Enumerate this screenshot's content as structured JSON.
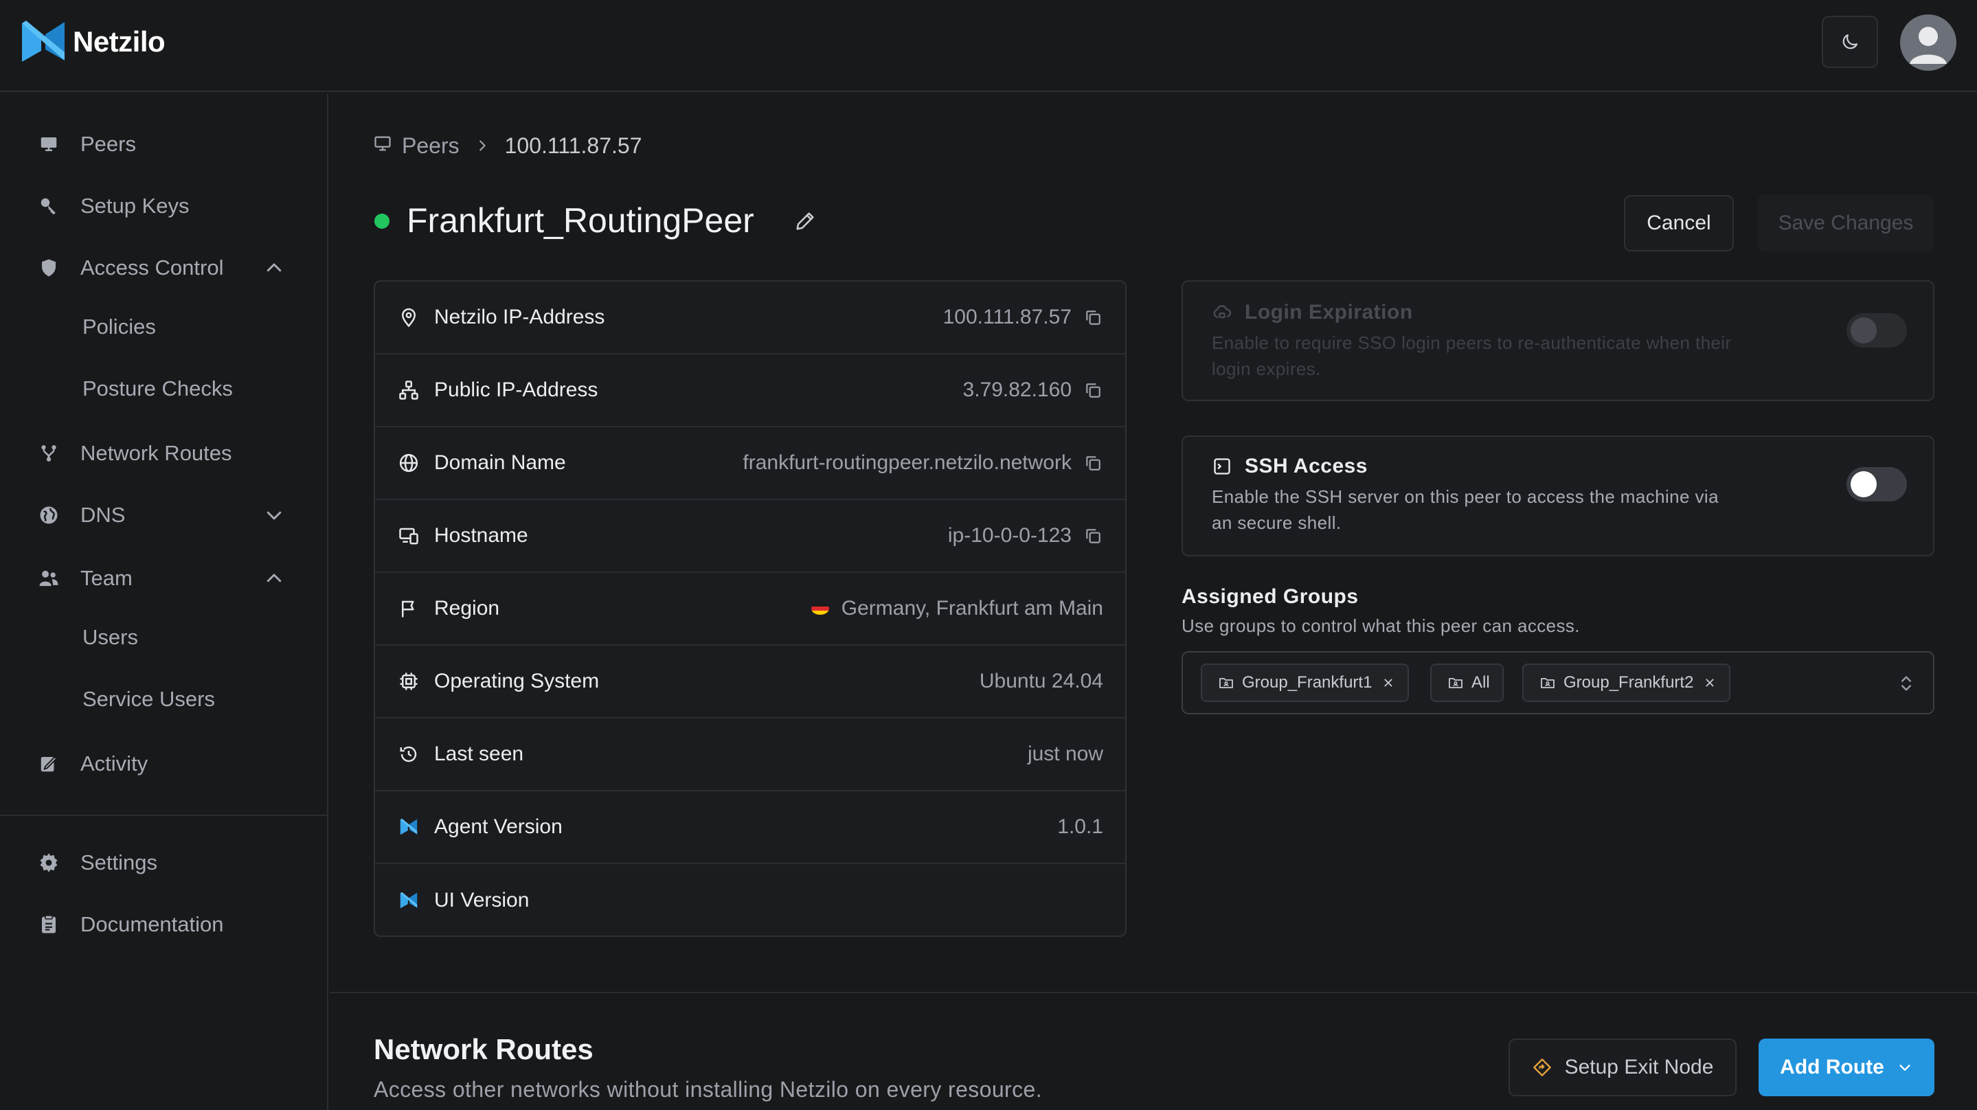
{
  "app": {
    "name": "Netzilo"
  },
  "sidebar": {
    "items": [
      {
        "label": "Peers",
        "icon": "monitor-icon"
      },
      {
        "label": "Setup Keys",
        "icon": "key-icon"
      },
      {
        "label": "Access Control",
        "icon": "shield-icon",
        "expanded": true
      },
      {
        "label": "Policies",
        "sub": true
      },
      {
        "label": "Posture Checks",
        "sub": true
      },
      {
        "label": "Network Routes",
        "icon": "route-icon"
      },
      {
        "label": "DNS",
        "icon": "globe-icon",
        "expanded": false
      },
      {
        "label": "Team",
        "icon": "team-icon",
        "expanded": true
      },
      {
        "label": "Users",
        "sub": true
      },
      {
        "label": "Service Users",
        "sub": true
      },
      {
        "label": "Activity",
        "icon": "activity-icon"
      },
      {
        "label": "Settings",
        "icon": "gear-icon"
      },
      {
        "label": "Documentation",
        "icon": "docs-icon"
      }
    ]
  },
  "breadcrumb": {
    "root": "Peers",
    "current": "100.111.87.57"
  },
  "peer": {
    "name": "Frankfurt_RoutingPeer",
    "status": "online"
  },
  "actions": {
    "cancel": "Cancel",
    "save": "Save Changes"
  },
  "details": [
    {
      "label": "Netzilo IP-Address",
      "value": "100.111.87.57",
      "icon": "pin-icon",
      "copy": true
    },
    {
      "label": "Public IP-Address",
      "value": "3.79.82.160",
      "icon": "network-icon",
      "copy": true
    },
    {
      "label": "Domain Name",
      "value": "frankfurt-routingpeer.netzilo.network",
      "icon": "globe-icon",
      "copy": true
    },
    {
      "label": "Hostname",
      "value": "ip-10-0-0-123",
      "icon": "devices-icon",
      "copy": true
    },
    {
      "label": "Region",
      "value": "Germany, Frankfurt am Main",
      "icon": "flag-icon",
      "copy": false
    },
    {
      "label": "Operating System",
      "value": "Ubuntu 24.04",
      "icon": "cpu-icon",
      "copy": false
    },
    {
      "label": "Last seen",
      "value": "just now",
      "icon": "history-icon",
      "copy": false
    },
    {
      "label": "Agent Version",
      "value": "1.0.1",
      "icon": "netzilo-logo-icon",
      "copy": false
    },
    {
      "label": "UI Version",
      "value": "",
      "icon": "netzilo-logo-icon",
      "copy": false
    }
  ],
  "login_expiration": {
    "title": "Login Expiration",
    "description": "Enable to require SSO login peers to re-authenticate when their login expires.",
    "enabled": false,
    "disabled": true
  },
  "ssh_access": {
    "title": "SSH Access",
    "description": "Enable the SSH server on this peer to access the machine via an secure shell.",
    "enabled": false
  },
  "assigned_groups": {
    "title": "Assigned Groups",
    "description": "Use groups to control what this peer can access.",
    "groups": [
      {
        "name": "Group_Frankfurt1",
        "removable": true
      },
      {
        "name": "All",
        "removable": false
      },
      {
        "name": "Group_Frankfurt2",
        "removable": true
      }
    ]
  },
  "network_routes": {
    "title": "Network Routes",
    "description": "Access other networks without installing Netzilo on every resource.",
    "setup_exit_node": "Setup Exit Node",
    "add_route": "Add Route"
  },
  "colors": {
    "background": "#18191b",
    "card": "#1b1c1f",
    "border": "#2e3034",
    "accent": "#2496e0",
    "online": "#22c55e",
    "brand": "#31a6e8"
  }
}
